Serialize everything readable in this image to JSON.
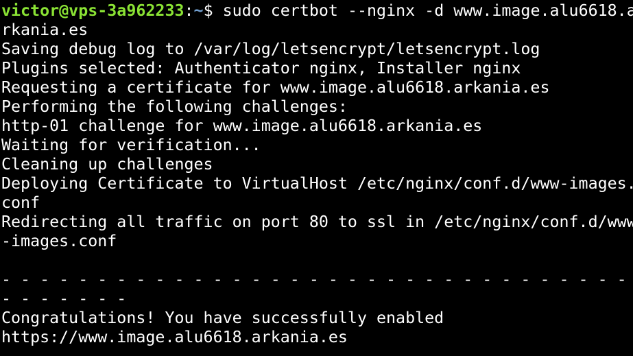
{
  "colors": {
    "background": "#000000",
    "text": "#ffffff",
    "prompt_user": "#8ae234",
    "prompt_path": "#729fcf"
  },
  "prompt": {
    "user_host": "victor@vps-3a962233",
    "colon": ":",
    "path": "~",
    "symbol": "$ ",
    "command": "sudo certbot --nginx -d www.image.alu6618.a"
  },
  "output_lines": [
    "rkania.es",
    "Saving debug log to /var/log/letsencrypt/letsencrypt.log",
    "Plugins selected: Authenticator nginx, Installer nginx",
    "Requesting a certificate for www.image.alu6618.arkania.es",
    "Performing the following challenges:",
    "http-01 challenge for www.image.alu6618.arkania.es",
    "Waiting for verification...",
    "Cleaning up challenges",
    "Deploying Certificate to VirtualHost /etc/nginx/conf.d/www-images.",
    "conf",
    "Redirecting all traffic on port 80 to ssl in /etc/nginx/conf.d/www",
    "-images.conf",
    "",
    "- - - - - - - - - - - - - - - - - - - - - - - - - - - - - - - - - -",
    "- - - - - - -",
    "Congratulations! You have successfully enabled",
    "https://www.image.alu6618.arkania.es"
  ]
}
